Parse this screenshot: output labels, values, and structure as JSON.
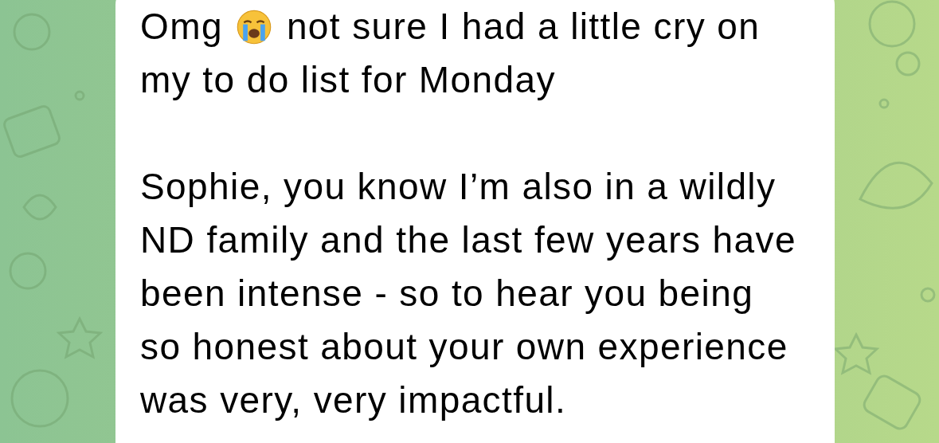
{
  "message": {
    "first_line_start": "Omg",
    "first_line_rest": "not sure I had a little cry on",
    "second_line": "my to do list for Monday",
    "paragraph": "Sophie, you know I’m also in a wildly ND family and the last few years have been intense - so to hear you being so honest about your own experience was very, very impactful."
  }
}
